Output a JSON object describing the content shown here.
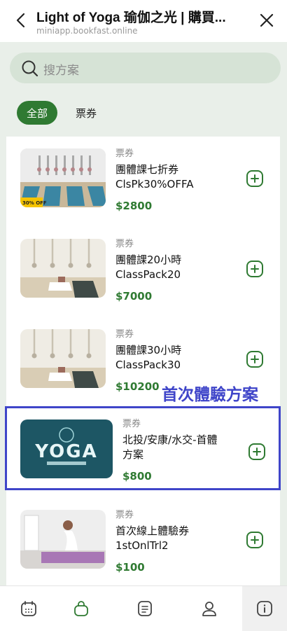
{
  "header": {
    "title": "Light of Yoga 瑜伽之光 | 購買...",
    "url": "miniapp.bookfast.online"
  },
  "search": {
    "placeholder": "搜方案"
  },
  "filters": [
    {
      "label": "全部",
      "active": true
    },
    {
      "label": "票券",
      "active": false
    }
  ],
  "products": [
    {
      "category": "票券",
      "name_line1": "團體課七折券",
      "name_line2": "ClsPk30%OFFA",
      "price": "$2800",
      "badge": "30% OFF"
    },
    {
      "category": "票券",
      "name_line1": "團體課20小時",
      "name_line2": "ClassPack20",
      "price": "$7000"
    },
    {
      "category": "票券",
      "name_line1": "團體課30小時",
      "name_line2": "ClassPack30",
      "price": "$10200"
    },
    {
      "category": "票券",
      "name_line1": "北投/安康/水交-首體",
      "name_line2": "方案",
      "price": "$800",
      "logo_text": "YOGA"
    },
    {
      "category": "票券",
      "name_line1": "首次線上體驗券",
      "name_line2": "1stOnlTrl2",
      "price": "$100"
    }
  ],
  "annotation": "首次體驗方案",
  "colors": {
    "accent": "#2f7a32",
    "annotation": "#3f45c9",
    "background": "#e9efe9"
  },
  "nav": [
    {
      "icon": "calendar-icon",
      "active": false
    },
    {
      "icon": "shopping-bag-icon",
      "active": true
    },
    {
      "icon": "document-icon",
      "active": false
    },
    {
      "icon": "user-icon",
      "active": false
    },
    {
      "icon": "info-icon",
      "active": false
    }
  ]
}
